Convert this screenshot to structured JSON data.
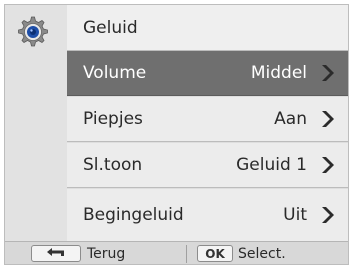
{
  "menu": {
    "title": "Geluid",
    "icon": "gear-icon",
    "items": [
      {
        "label": "Volume",
        "value": "Middel",
        "selected": true
      },
      {
        "label": "Piepjes",
        "value": "Aan",
        "selected": false
      },
      {
        "label": "Sl.toon",
        "value": "Geluid 1",
        "selected": false
      },
      {
        "label": "Begingeluid",
        "value": "Uit",
        "selected": false
      }
    ]
  },
  "footer": {
    "back_label": "Terug",
    "ok_key": "OK",
    "select_label": "Select."
  },
  "colors": {
    "selected_row": "#6f6f6f",
    "row": "#ececec",
    "chevron": "#2b2b2b",
    "gear_blue": "#1e4ea8"
  }
}
